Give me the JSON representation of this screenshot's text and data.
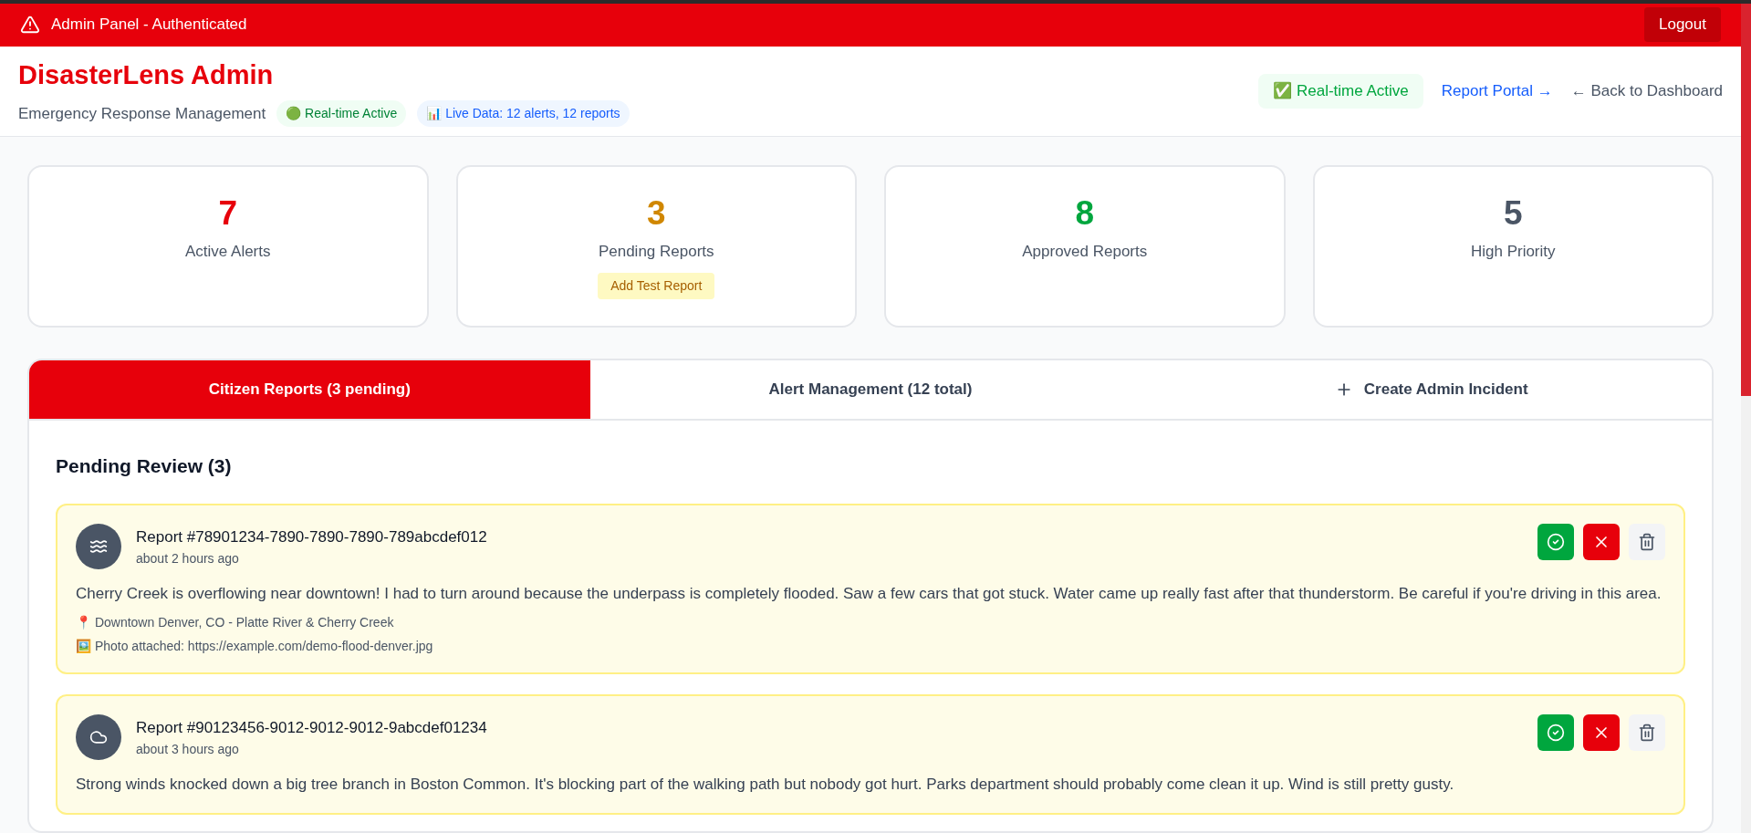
{
  "top_bar": {
    "title": "Admin Panel - Authenticated",
    "logout": "Logout"
  },
  "header": {
    "title": "DisasterLens Admin",
    "subtitle": "Emergency Response Management",
    "badges": [
      {
        "text": "🟢 Real-time Active",
        "kind": "green"
      },
      {
        "text": "📊 Live Data: 12 alerts, 12 reports",
        "kind": "blue"
      }
    ],
    "status": "✅ Real-time Active",
    "links": [
      {
        "text": "Report Portal →",
        "kind": "primary"
      },
      {
        "text": "← Back to Dashboard",
        "kind": "muted"
      }
    ]
  },
  "stats": [
    {
      "value": "7",
      "label": "Active Alerts",
      "color": "#e7000b"
    },
    {
      "value": "3",
      "label": "Pending Reports",
      "color": "#d08700",
      "action": "Add Test Report"
    },
    {
      "value": "8",
      "label": "Approved Reports",
      "color": "#00a63e"
    },
    {
      "value": "5",
      "label": "High Priority",
      "color": "#4a5565"
    }
  ],
  "tabs": [
    {
      "label": "Citizen Reports (3 pending)",
      "selected": true
    },
    {
      "label": "Alert Management (12 total)",
      "selected": false
    },
    {
      "label": "Create Admin Incident",
      "selected": false,
      "kind": "create"
    }
  ],
  "section_title": "Pending Review (3)",
  "reports": [
    {
      "title": "Report #78901234-7890-7890-7890-789abcdef012",
      "time": "about 2 hours ago",
      "kind": "flood",
      "text": "Cherry Creek is overflowing near downtown! I had to turn around because the underpass is completely flooded. Saw a few cars that got stuck. Water came up really fast after that thunderstorm. Be careful if you're driving in this area.",
      "location": "📍 Downtown Denver, CO - Platte River & Cherry Creek",
      "photo": "🖼️ Photo attached: https://example.com/demo-flood-denver.jpg"
    },
    {
      "title": "Report #90123456-9012-9012-9012-9abcdef01234",
      "time": "about 3 hours ago",
      "kind": "storm",
      "text": "Strong winds knocked down a big tree branch in Boston Common. It's blocking part of the walking path but nobody got hurt. Parks department should probably come clean it up. Wind is still pretty gusty."
    }
  ]
}
